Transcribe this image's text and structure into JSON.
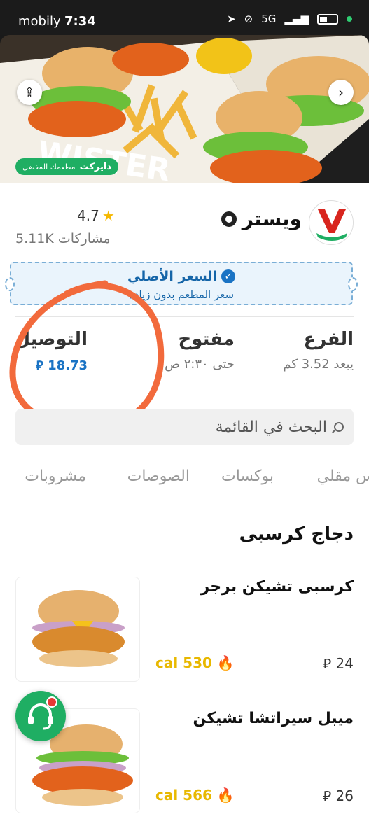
{
  "status_bar": {
    "carrier": "mobily",
    "time": "7:34",
    "network": "5G"
  },
  "hero": {
    "badge_prefix": "مطعمك المفضل",
    "badge_brand": "دايركت",
    "photo_text": "WISTER"
  },
  "restaurant": {
    "name": "ويستر",
    "rating": "4.7",
    "reviews": "5.11K مشاركات"
  },
  "price_banner": {
    "title": "السعر الأصلي",
    "subtitle": "سعر المطعم بدون زيادة"
  },
  "info": {
    "branch_label": "الفرع",
    "branch_value": "يبعد 3.52 كم",
    "open_label": "مفتوح",
    "open_value": "حتى ٢:٣٠ ص",
    "delivery_label": "التوصيل",
    "delivery_value": "18.73 ⃁"
  },
  "search": {
    "placeholder": "البحث في القائمة"
  },
  "tabs": [
    "س مقلي",
    "بوكسات",
    "الصوصات",
    "مشروبات"
  ],
  "section": {
    "title": "دجاج كرسبى"
  },
  "items": [
    {
      "name": "كرسبى تشيكن برجر",
      "price": "24 ⃁",
      "calories": "cal 530"
    },
    {
      "name": "ميبل سيراتشا تشيكن",
      "price": "26 ⃁",
      "calories": "cal 566"
    }
  ],
  "colors": {
    "accent_green": "#1fae63",
    "price_blue": "#1a73c4",
    "calorie_yellow": "#e8b800",
    "annotation": "#f26a3c"
  },
  "icons": [
    "share-icon",
    "chevron-right-icon",
    "star-icon",
    "check-icon",
    "search-icon",
    "flame-icon",
    "headset-icon"
  ]
}
